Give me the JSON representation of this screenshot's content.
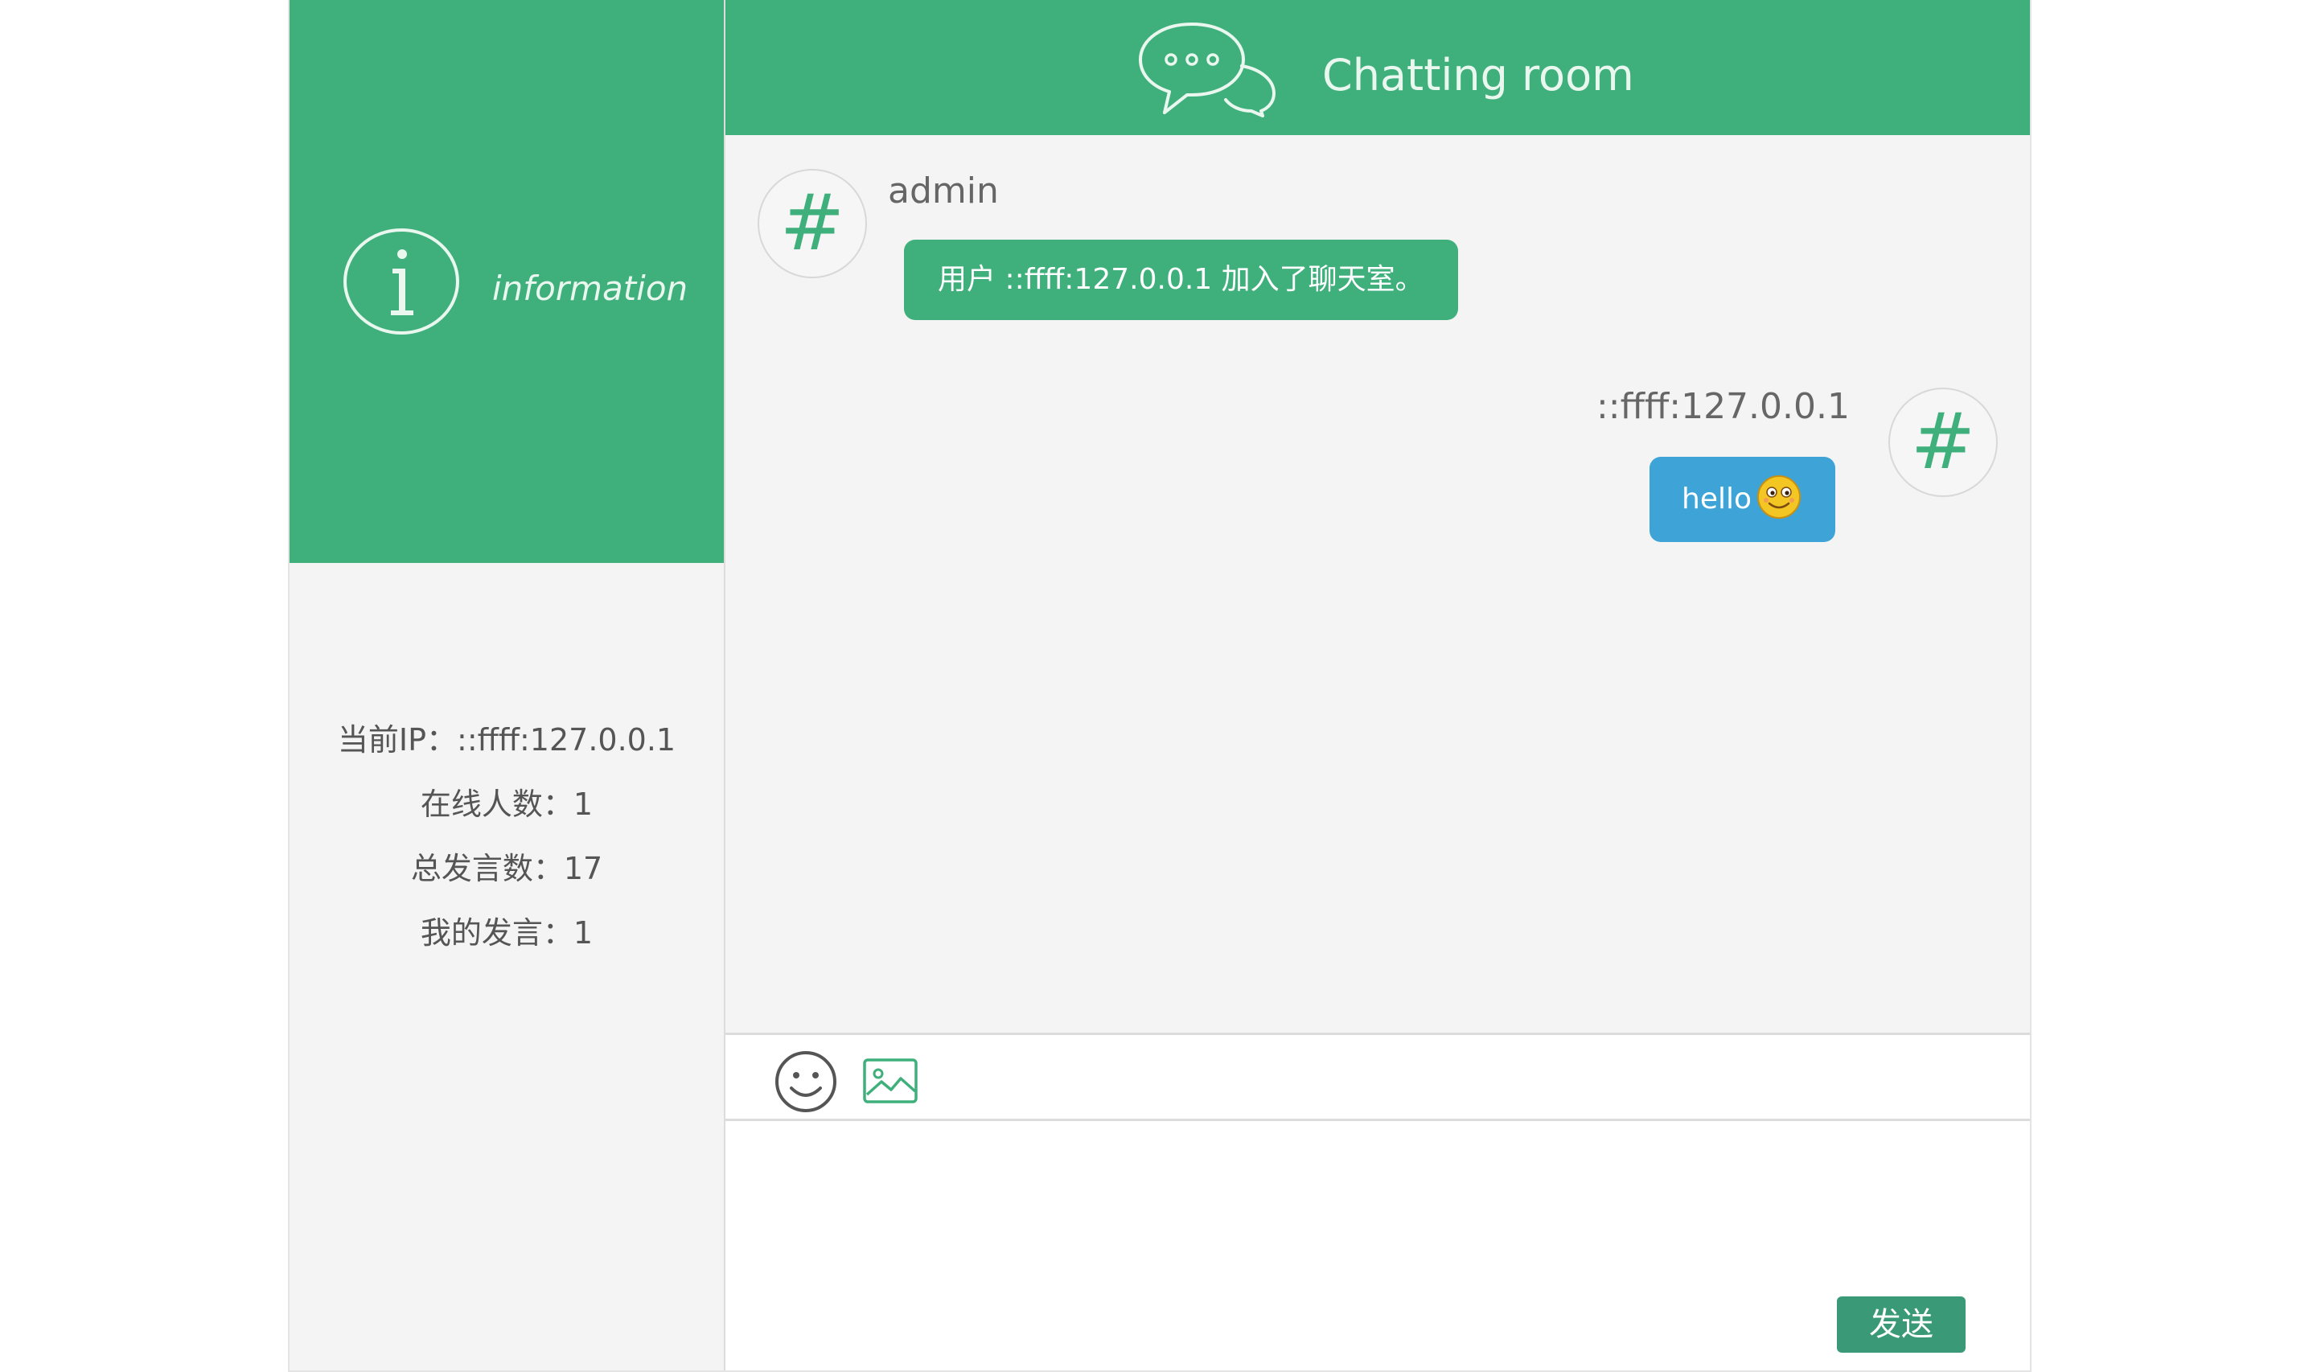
{
  "sidebar": {
    "info_label": "information",
    "stats": [
      {
        "text": "当前IP：::ffff:127.0.0.1"
      },
      {
        "text": "在线人数：1"
      },
      {
        "text": "总发言数：17"
      },
      {
        "text": "我的发言：1"
      }
    ]
  },
  "header": {
    "title": "Chatting room"
  },
  "messages": [
    {
      "side": "left",
      "avatar_text": "#",
      "sender": "admin",
      "text": "用户 ::ffff:127.0.0.1 加入了聊天室。"
    },
    {
      "side": "right",
      "avatar_text": "#",
      "sender": "::ffff:127.0.0.1",
      "text": "hello",
      "emoji": "smiley-emoji"
    }
  ],
  "toolbar": {
    "emoji_icon": "smiley-face-icon",
    "image_icon": "image-icon"
  },
  "composer": {
    "value": "",
    "send_label": "发送"
  },
  "colors": {
    "brand": "#3fb07c",
    "bubble_self": "#3ea4d8",
    "send_button": "#3a9a78",
    "panel": "#f4f4f4"
  }
}
